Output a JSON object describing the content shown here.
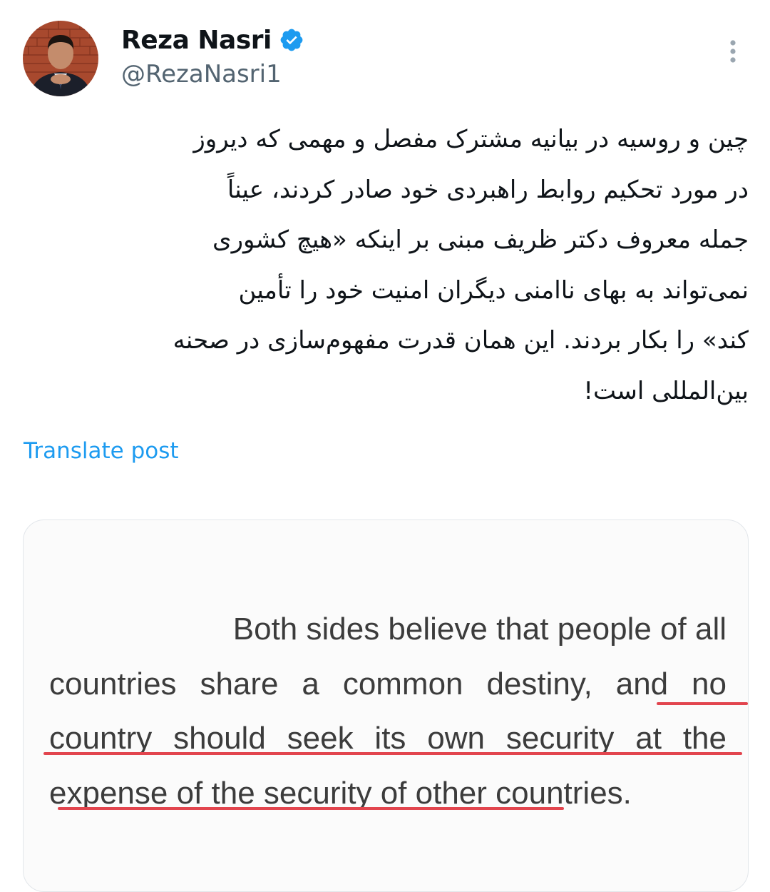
{
  "author": {
    "display_name": "Reza Nasri",
    "handle": "@RezaNasri1",
    "verified": true,
    "avatar_icon": "avatar-photo-icon",
    "verified_icon": "verified-badge-icon"
  },
  "header": {
    "more_icon": "more-vertical-icon"
  },
  "tweet": {
    "lines": [
      "چین و روسیه در بیانیه مشترک مفصل و مهمی که دیروز",
      "در مورد تحکیم روابط راهبردی خود صادر کردند، عیناً",
      "جمله معروف دکتر ظریف مبنی بر اینکه «هیچ کشوری",
      "نمی‌تواند به بهای ناامنی دیگران امنیت خود را تأمین",
      "کند» را بکار بردند. این همان قدرت مفهوم‌سازی در صحنه",
      "بین‌المللی است!"
    ],
    "translate_label": "Translate post"
  },
  "media": {
    "quote_lines": [
      "Both sides believe that people of all",
      "countries share a common destiny, and no",
      "country should seek its own security at the",
      "expense of the security of other countries."
    ],
    "underline_color": "#e2454e"
  },
  "colors": {
    "text": "#0f1419",
    "secondary": "#536471",
    "link": "#1d9bf0",
    "verified": "#1d9bf0"
  }
}
